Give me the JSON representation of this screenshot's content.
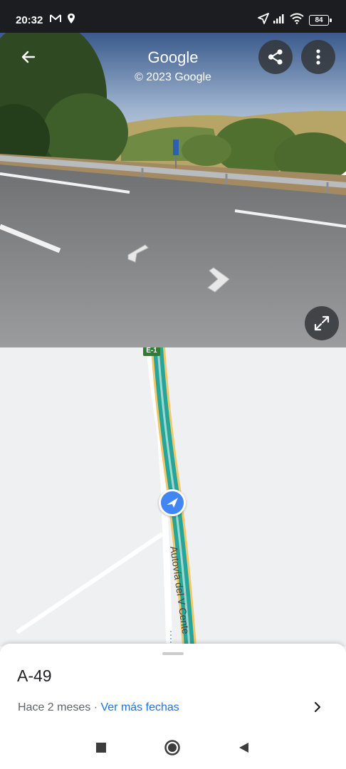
{
  "status_bar": {
    "time": "20:32",
    "battery": "84"
  },
  "street_view": {
    "title": "Google",
    "copyright": "© 2023 Google"
  },
  "map": {
    "road_label": "Autovía del V Cente",
    "shield": "E-1"
  },
  "sheet": {
    "title": "A-49",
    "age": "Hace 2 meses",
    "separator": " · ",
    "more_dates_link": "Ver más fechas"
  },
  "colors": {
    "accent": "#1a73e8",
    "motorway": "#26a69a",
    "location_dot": "#4285f4"
  }
}
